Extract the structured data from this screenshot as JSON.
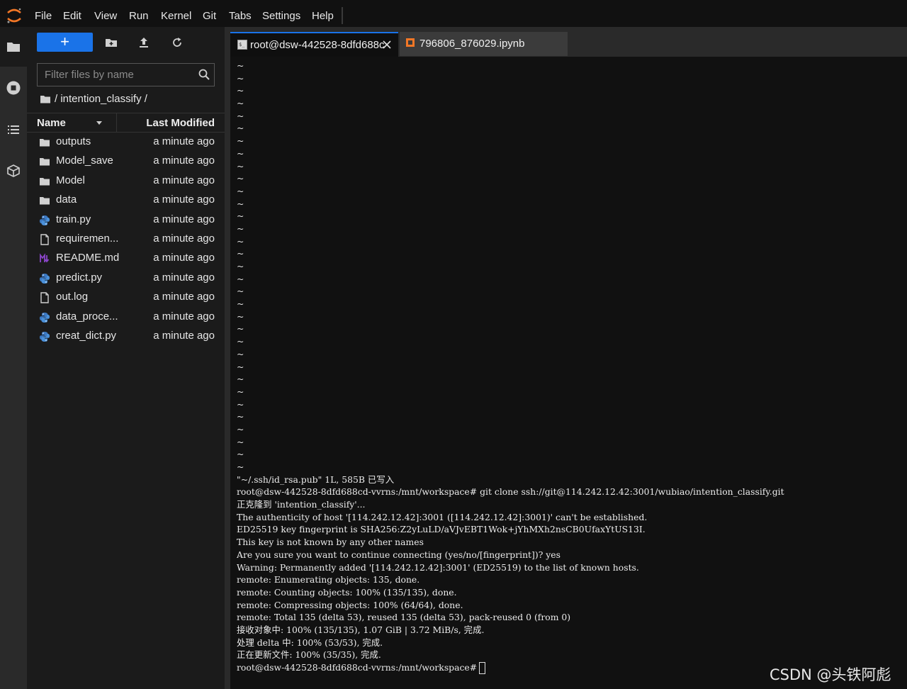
{
  "menubar": {
    "items": [
      "File",
      "Edit",
      "View",
      "Run",
      "Kernel",
      "Git",
      "Tabs",
      "Settings",
      "Help"
    ]
  },
  "activity_bar": {
    "icons": [
      "folder-icon",
      "running-icon",
      "toc-icon",
      "extension-icon"
    ]
  },
  "filebrowser": {
    "new_button_label": "+",
    "filter_placeholder": "Filter files by name",
    "breadcrumb": "/ intention_classify /",
    "columns": {
      "name": "Name",
      "modified": "Last Modified"
    },
    "files": [
      {
        "name": "outputs",
        "icon": "folder-icon",
        "modified": "a minute ago"
      },
      {
        "name": "Model_save",
        "icon": "folder-icon",
        "modified": "a minute ago"
      },
      {
        "name": "Model",
        "icon": "folder-icon",
        "modified": "a minute ago"
      },
      {
        "name": "data",
        "icon": "folder-icon",
        "modified": "a minute ago"
      },
      {
        "name": "train.py",
        "icon": "python-file-icon",
        "modified": "a minute ago"
      },
      {
        "name": "requiremen...",
        "icon": "text-file-icon",
        "modified": "a minute ago"
      },
      {
        "name": "README.md",
        "icon": "markdown-file-icon",
        "modified": "a minute ago"
      },
      {
        "name": "predict.py",
        "icon": "python-file-icon",
        "modified": "a minute ago"
      },
      {
        "name": "out.log",
        "icon": "text-file-icon",
        "modified": "a minute ago"
      },
      {
        "name": "data_proce...",
        "icon": "python-file-icon",
        "modified": "a minute ago"
      },
      {
        "name": "creat_dict.py",
        "icon": "python-file-icon",
        "modified": "a minute ago"
      }
    ]
  },
  "tabs": [
    {
      "label": "root@dsw-442528-8dfd688c",
      "icon": "terminal-icon",
      "active": true
    },
    {
      "label": "796806_876029.ipynb",
      "icon": "notebook-icon",
      "active": false
    }
  ],
  "terminal": {
    "tilde_count": 33,
    "tilde": "~",
    "lines": [
      "\"~/.ssh/id_rsa.pub\" 1L, 585B 已写入",
      "root@dsw-442528-8dfd688cd-vvrns:/mnt/workspace# git clone ssh://git@114.242.12.42:3001/wubiao/intention_classify.git",
      "正克隆到 'intention_classify'...",
      "The authenticity of host '[114.242.12.42]:3001 ([114.242.12.42]:3001)' can't be established.",
      "ED25519 key fingerprint is SHA256:Z2yLuLD/aVJvEBT1Wok+jYhMXh2nsCB0UfaxYtUS13I.",
      "This key is not known by any other names",
      "Are you sure you want to continue connecting (yes/no/[fingerprint])? yes",
      "Warning: Permanently added '[114.242.12.42]:3001' (ED25519) to the list of known hosts.",
      "remote: Enumerating objects: 135, done.",
      "remote: Counting objects: 100% (135/135), done.",
      "remote: Compressing objects: 100% (64/64), done.",
      "remote: Total 135 (delta 53), reused 135 (delta 53), pack-reused 0 (from 0)",
      "接收对象中: 100% (135/135), 1.07 GiB | 3.72 MiB/s, 完成.",
      "处理 delta 中: 100% (53/53), 完成.",
      "正在更新文件: 100% (35/35), 完成."
    ],
    "prompt": "root@dsw-442528-8dfd688cd-vvrns:/mnt/workspace#"
  },
  "watermark": "CSDN @头铁阿彪",
  "colors": {
    "accent": "#1a73e8",
    "logo_orange": "#f37726",
    "python_blue": "#2f7fd0",
    "markdown_purple": "#7b3fc4"
  }
}
